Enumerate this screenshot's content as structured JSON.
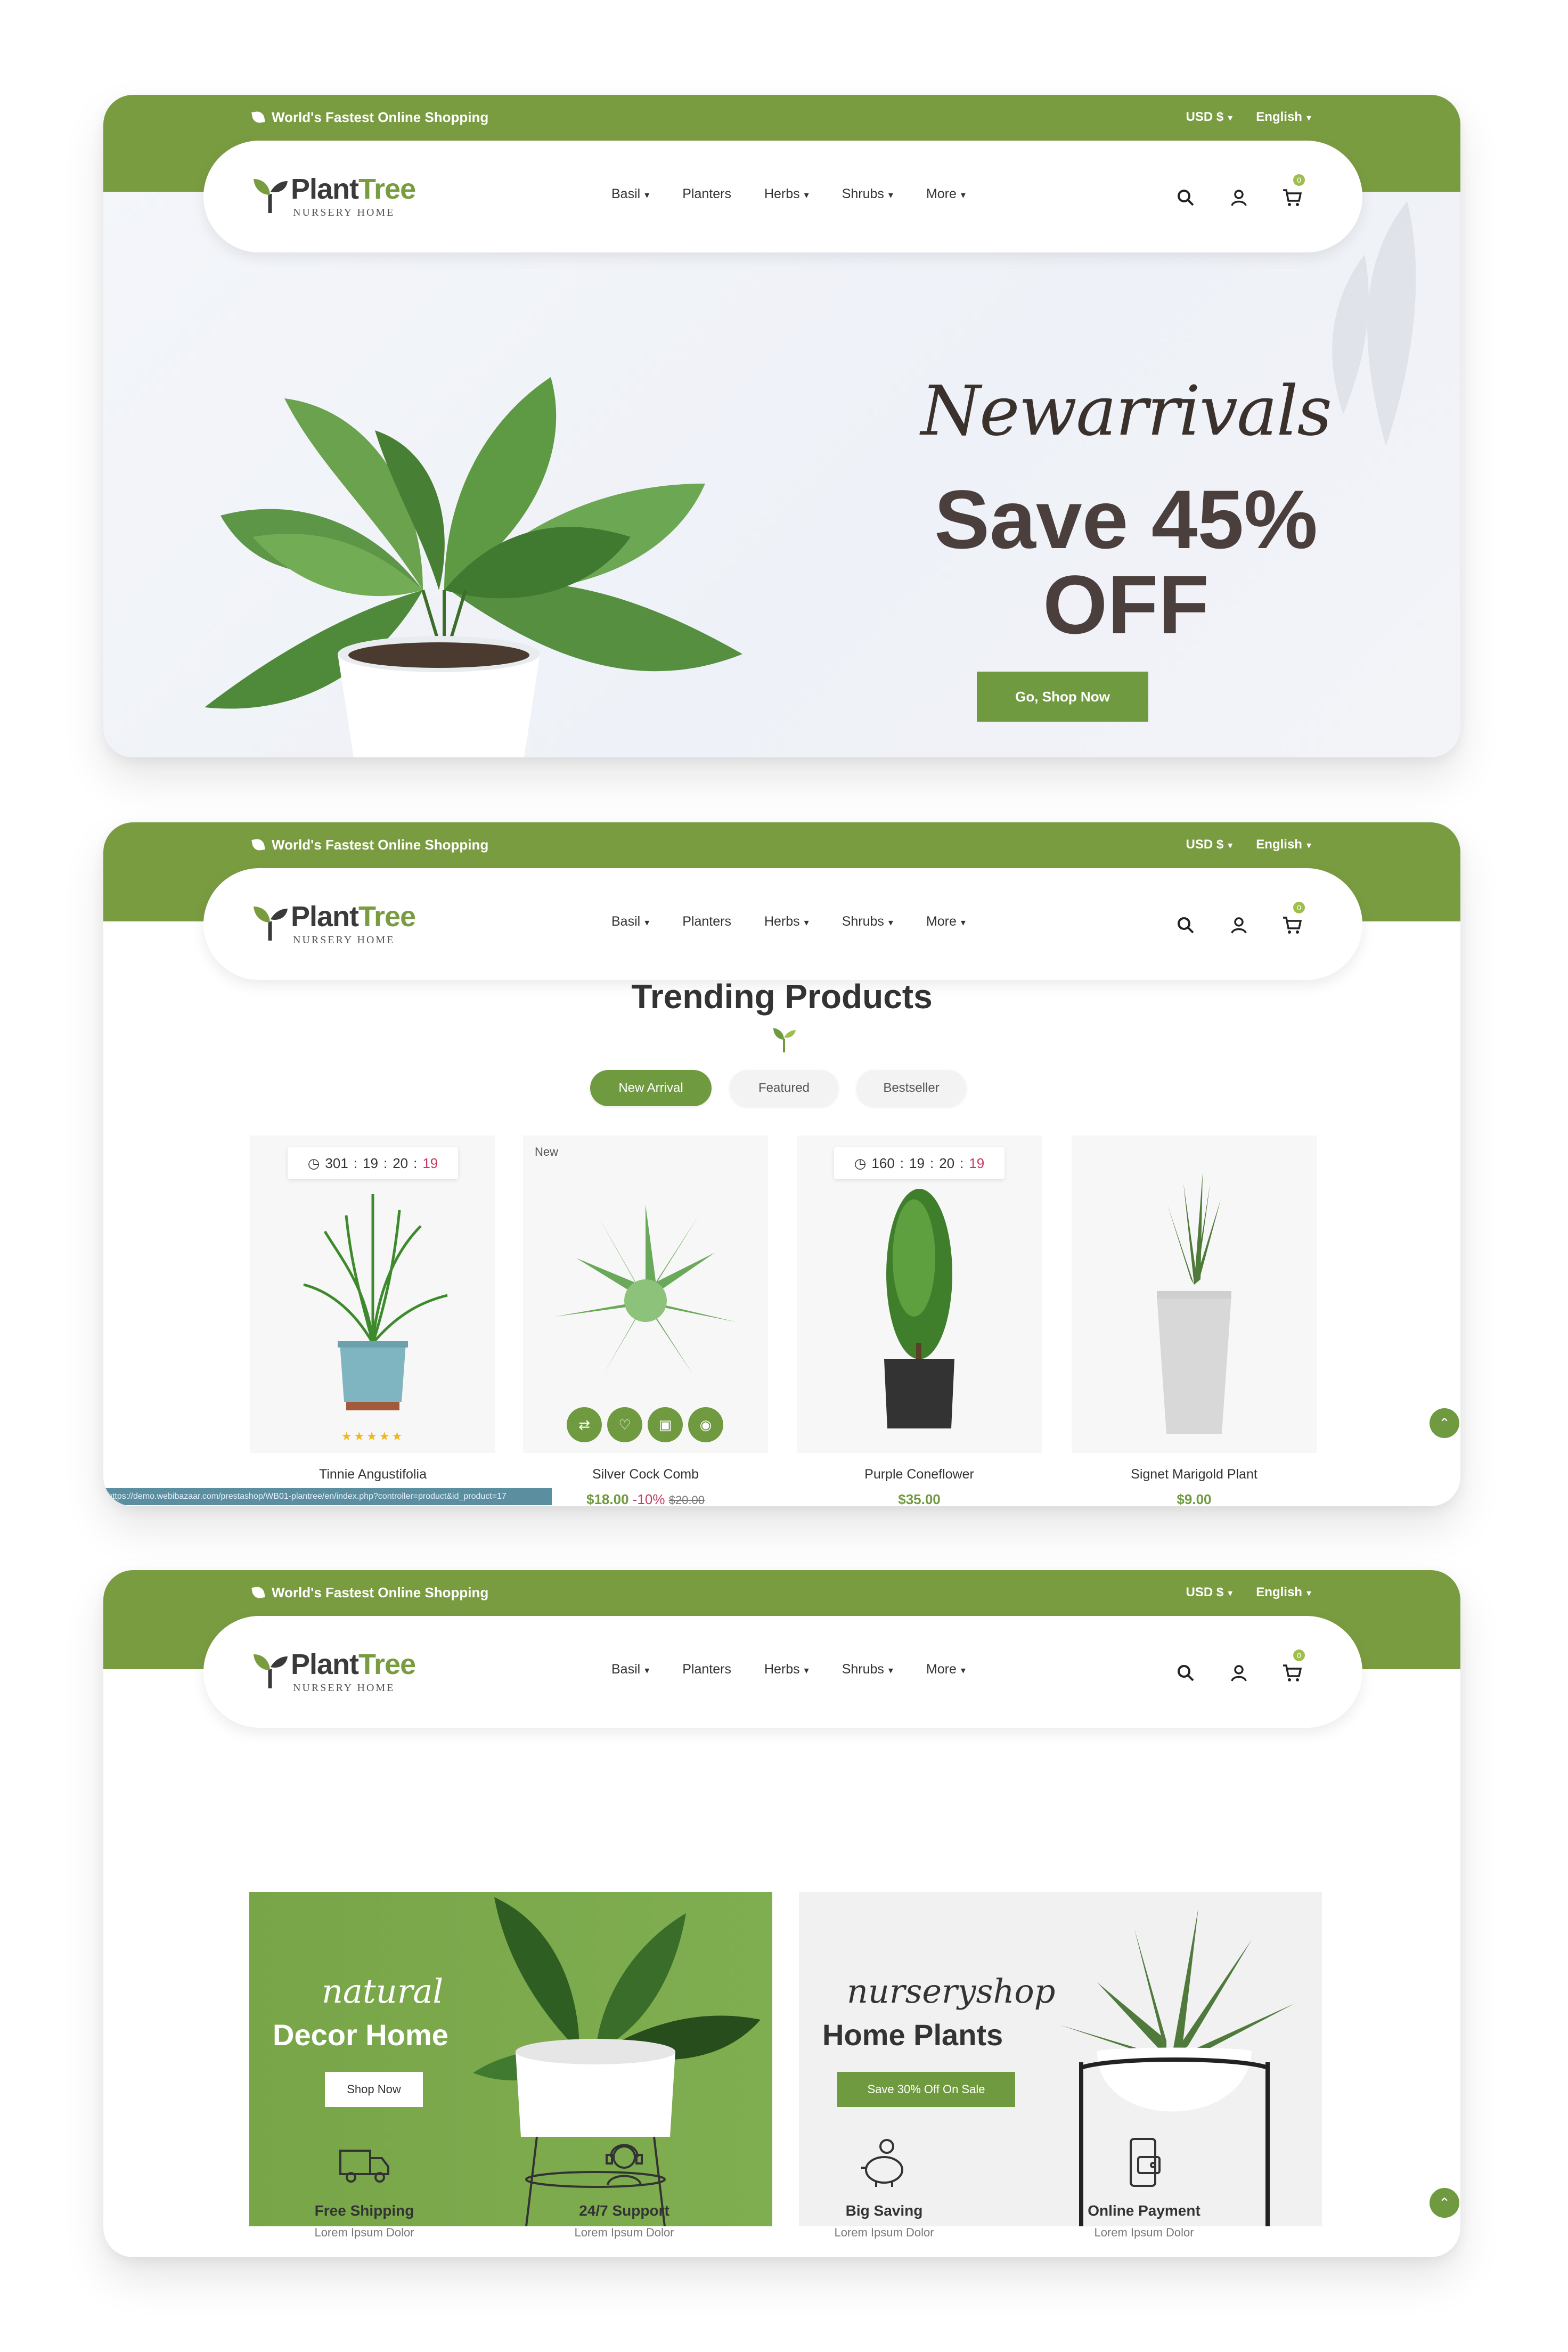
{
  "common": {
    "topbar_message": "World's Fastest Online Shopping",
    "currency": "USD $",
    "language": "English",
    "logo_plant": "Plant",
    "logo_tree": "Tree",
    "logo_sub": "NURSERY HOME",
    "menu": [
      "Basil",
      "Planters",
      "Herbs",
      "Shrubs",
      "More"
    ],
    "cart_count": "0",
    "brand_color": "#7a9c41"
  },
  "hero": {
    "script": "Newarrivals",
    "headline1": "Save 45%",
    "headline2": "OFF",
    "button": "Go, Shop Now"
  },
  "trending": {
    "title": "Trending Products",
    "tabs": [
      "New Arrival",
      "Featured",
      "Bestseller"
    ],
    "products": [
      {
        "name": "Tinnie Angustifolia",
        "price": "",
        "timer": [
          "301",
          "19",
          "20",
          "19"
        ],
        "rating": "★★★★★"
      },
      {
        "name": "Silver Cock Comb",
        "price": "$18.00",
        "discount": "-10%",
        "old_price": "$20.00",
        "tag": "New"
      },
      {
        "name": "Purple Coneflower",
        "price": "$35.00",
        "timer": [
          "160",
          "19",
          "20",
          "19"
        ]
      },
      {
        "name": "Signet Marigold Plant",
        "price": "$9.00"
      }
    ],
    "status_url": "https://demo.webibazaar.com/prestashop/WB01-plantree/en/index.php?controller=product&id_product=17"
  },
  "banners": [
    {
      "script": "natural",
      "heading": "Decor Home",
      "button": "Shop Now"
    },
    {
      "script": "nurseryshop",
      "heading": "Home Plants",
      "button": "Save 30% Off On Sale"
    }
  ],
  "features": [
    {
      "title": "Free Shipping",
      "sub": "Lorem Ipsum Dolor",
      "icon": "truck-icon"
    },
    {
      "title": "24/7 Support",
      "sub": "Lorem Ipsum Dolor",
      "icon": "headset-icon"
    },
    {
      "title": "Big Saving",
      "sub": "Lorem Ipsum Dolor",
      "icon": "piggy-bank-icon"
    },
    {
      "title": "Online Payment",
      "sub": "Lorem Ipsum Dolor",
      "icon": "wallet-icon"
    }
  ]
}
